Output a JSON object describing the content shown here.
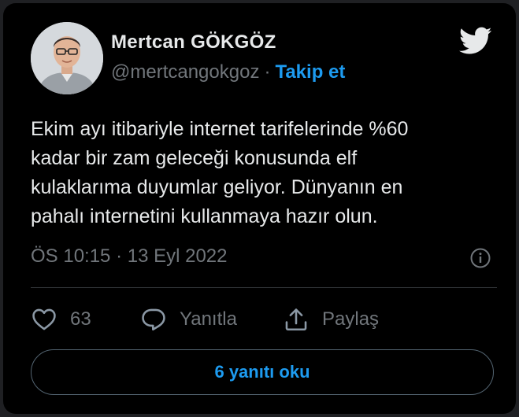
{
  "tweet": {
    "author_name": "Mertcan GÖKGÖZ",
    "author_handle": "@mertcangokgoz",
    "separator": "·",
    "follow_label": "Takip et",
    "text": "Ekim ayı itibariyle internet tarifelerinde %60\nkadar bir zam geleceği konusunda elf\nkulaklarıma duyumlar geliyor. Dünyanın en\npahalı internetini kullanmaya hazır olun.",
    "timestamp": "ÖS 10:15 · 13 Eyl 2022",
    "like_count": "63",
    "reply_label": "Yanıtla",
    "share_label": "Paylaş",
    "read_replies_label": "6 yanıtı oku"
  },
  "icons": {
    "brand": "twitter-bird-icon",
    "info": "info-icon",
    "like": "heart-icon",
    "reply": "comment-icon",
    "share": "share-icon"
  },
  "colors": {
    "background": "#000000",
    "text": "#e7e9ea",
    "muted": "#71767b",
    "accent": "#1d9bf0",
    "divider": "#2f3336"
  }
}
